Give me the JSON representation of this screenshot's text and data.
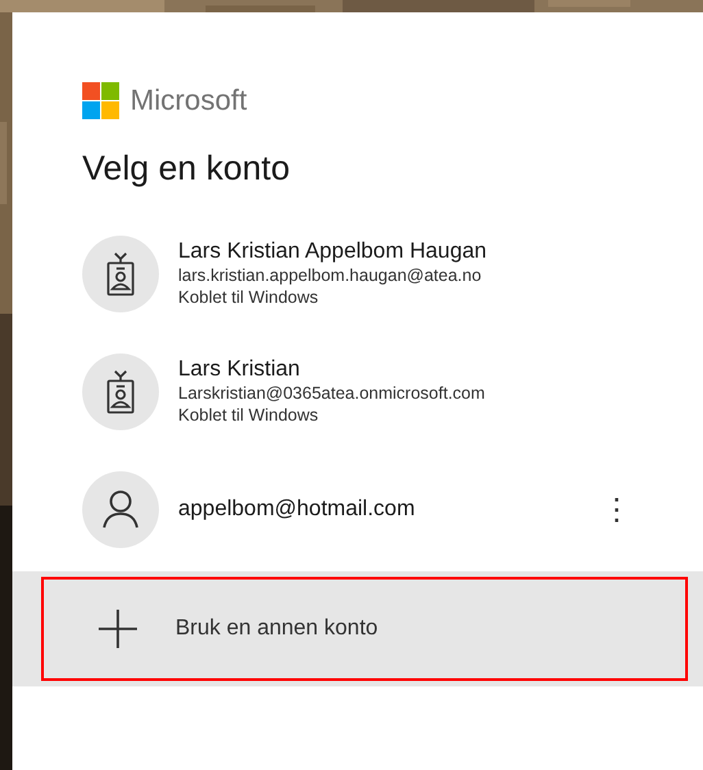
{
  "brand": {
    "name": "Microsoft"
  },
  "title": "Velg en konto",
  "accounts": [
    {
      "kind": "work",
      "name": "Lars Kristian Appelbom Haugan",
      "email": "lars.kristian.appelbom.haugan@atea.no",
      "status": "Koblet til Windows"
    },
    {
      "kind": "work",
      "name": "Lars Kristian",
      "email": "Larskristian@0365atea.onmicrosoft.com",
      "status": "Koblet til Windows"
    },
    {
      "kind": "personal",
      "email": "appelbom@hotmail.com",
      "more": "⋮"
    }
  ],
  "add_account": {
    "label": "Bruk en annen konto",
    "highlighted": true
  }
}
